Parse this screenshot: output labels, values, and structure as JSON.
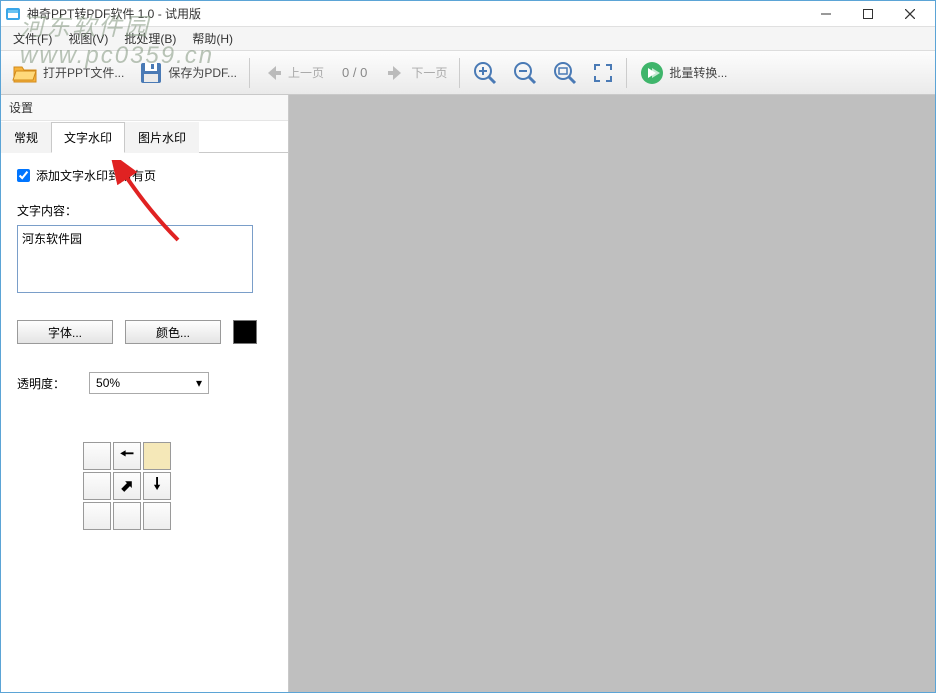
{
  "titlebar": {
    "title": "神奇PPT转PDF软件 1.0 - 试用版"
  },
  "menubar": {
    "file": "文件(F)",
    "view": "视图(V)",
    "batch": "批处理(B)",
    "help": "帮助(H)"
  },
  "toolbar": {
    "open": "打开PPT文件...",
    "save": "保存为PDF...",
    "prev": "上一页",
    "next": "下一页",
    "page_count": "0 / 0",
    "batch": "批量转换..."
  },
  "sidebar": {
    "title": "设置",
    "tabs": {
      "general": "常规",
      "text_wm": "文字水印",
      "image_wm": "图片水印"
    },
    "text_wm": {
      "add_all": "添加文字水印到所有页",
      "content_label": "文字内容：",
      "content_value": "河东软件园",
      "font_btn": "字体...",
      "color_btn": "颜色...",
      "color_value": "#000000",
      "opacity_label": "透明度：",
      "opacity_value": "50%"
    }
  },
  "watermark": {
    "line1": "河东软件园",
    "line2": "www.pc0359.cn"
  }
}
